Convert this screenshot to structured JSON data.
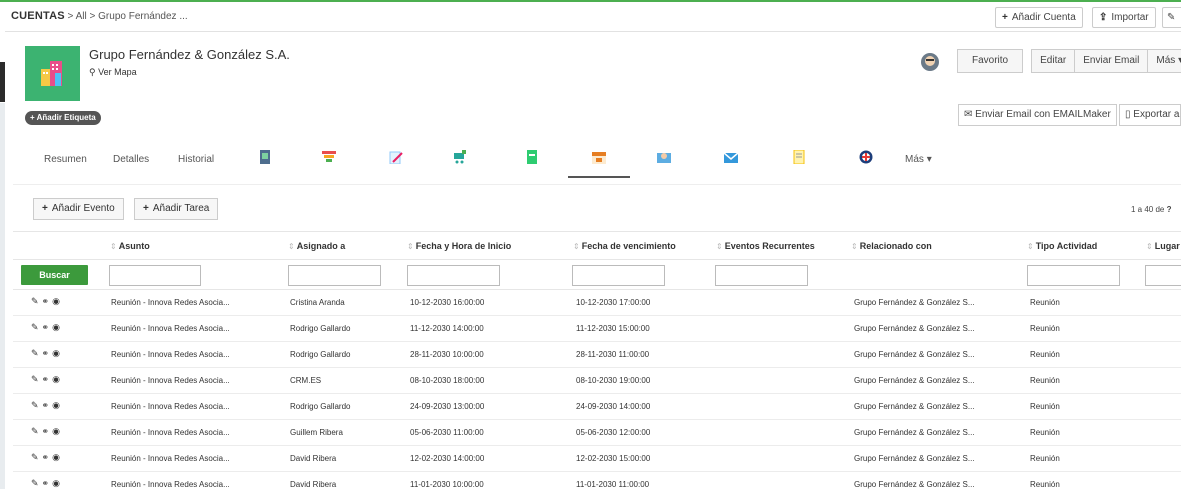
{
  "breadcrumb": {
    "module": "CUENTAS",
    "sep1": ">",
    "all": "All",
    "sep2": ">",
    "record": "Grupo Fernández ..."
  },
  "topbar": {
    "add_account": "Añadir Cuenta",
    "import": "Importar"
  },
  "record": {
    "name": "Grupo Fernández & González S.A.",
    "map_link": "Ver Mapa",
    "add_tag": "+ Añadir Etiqueta",
    "favorite": "Favorito",
    "edit": "Editar",
    "send_email": "Enviar Email",
    "more": "Más",
    "emailmaker": "Enviar Email con EMAILMaker",
    "export": "Exportar a"
  },
  "tabs": {
    "summary": "Resumen",
    "details": "Detalles",
    "history": "Historial",
    "more": "Más"
  },
  "actions": {
    "add_event": "Añadir Evento",
    "add_task": "Añadir Tarea"
  },
  "pager": {
    "range": "1 a 40",
    "of": "de",
    "total": "?"
  },
  "table": {
    "search_label": "Buscar",
    "headers": [
      "Asunto",
      "Asignado a",
      "Fecha y Hora de Inicio",
      "Fecha de vencimiento",
      "Eventos Recurrentes",
      "Relacionado con",
      "Tipo Actividad",
      "Lugar"
    ],
    "rows": [
      {
        "subject": "Reunión - Innova Redes Asocia...",
        "assigned": "Cristina Aranda",
        "start": "10-12-2030 16:00:00",
        "due": "10-12-2030 17:00:00",
        "related": "Grupo Fernández & González S...",
        "type": "Reunión"
      },
      {
        "subject": "Reunión - Innova Redes Asocia...",
        "assigned": "Rodrigo Gallardo",
        "start": "11-12-2030 14:00:00",
        "due": "11-12-2030 15:00:00",
        "related": "Grupo Fernández & González S...",
        "type": "Reunión"
      },
      {
        "subject": "Reunión - Innova Redes Asocia...",
        "assigned": "Rodrigo Gallardo",
        "start": "28-11-2030 10:00:00",
        "due": "28-11-2030 11:00:00",
        "related": "Grupo Fernández & González S...",
        "type": "Reunión"
      },
      {
        "subject": "Reunión - Innova Redes Asocia...",
        "assigned": "CRM.ES",
        "start": "08-10-2030 18:00:00",
        "due": "08-10-2030 19:00:00",
        "related": "Grupo Fernández & González S...",
        "type": "Reunión"
      },
      {
        "subject": "Reunión - Innova Redes Asocia...",
        "assigned": "Rodrigo Gallardo",
        "start": "24-09-2030 13:00:00",
        "due": "24-09-2030 14:00:00",
        "related": "Grupo Fernández & González S...",
        "type": "Reunión"
      },
      {
        "subject": "Reunión - Innova Redes Asocia...",
        "assigned": "Guillem Ribera",
        "start": "05-06-2030 11:00:00",
        "due": "05-06-2030 12:00:00",
        "related": "Grupo Fernández & González S...",
        "type": "Reunión"
      },
      {
        "subject": "Reunión - Innova Redes Asocia...",
        "assigned": "David Ribera",
        "start": "12-02-2030 14:00:00",
        "due": "12-02-2030 15:00:00",
        "related": "Grupo Fernández & González S...",
        "type": "Reunión"
      },
      {
        "subject": "Reunión - Innova Redes Asocia...",
        "assigned": "David Ribera",
        "start": "11-01-2030 10:00:00",
        "due": "11-01-2030 11:00:00",
        "related": "Grupo Fernández & González S...",
        "type": "Reunión"
      }
    ]
  },
  "colors": {
    "accent": "#4caf50",
    "logo": "#3cb371",
    "search_button": "#3c9a3c"
  },
  "icons": [
    "pencil-icon",
    "link-icon",
    "eye-icon",
    "plus-icon",
    "upload-icon",
    "caret-down-icon",
    "map-marker-icon",
    "envelope-icon",
    "file-icon"
  ]
}
